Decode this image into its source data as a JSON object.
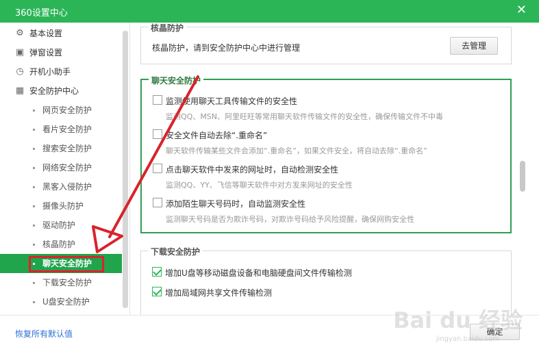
{
  "window": {
    "title": "360设置中心",
    "close_glyph": "✕"
  },
  "sidebar": {
    "items": [
      {
        "label": "基本设置",
        "icon": "gear-icon",
        "glyph": "⚙"
      },
      {
        "label": "弹窗设置",
        "icon": "window-icon",
        "glyph": "▣"
      },
      {
        "label": "开机小助手",
        "icon": "timer-icon",
        "glyph": "◷"
      },
      {
        "label": "安全防护中心",
        "icon": "shield-icon",
        "glyph": "▦"
      }
    ],
    "subitems": [
      "网页安全防护",
      "看片安全防护",
      "搜索安全防护",
      "网络安全防护",
      "黑客入侵防护",
      "摄像头防护",
      "驱动防护",
      "核晶防护",
      "聊天安全防护",
      "下载安全防护",
      "U盘安全防护"
    ],
    "active_index": 8
  },
  "core_protect": {
    "title": "核晶防护",
    "description": "核晶防护，请到安全防护中心中进行管理",
    "button": "去管理"
  },
  "chat_protect": {
    "title": "聊天安全防护",
    "options": [
      {
        "label": "监测使用聊天工具传输文件的安全性",
        "desc": "监测QQ、MSN、阿里旺旺等常用聊天软件传输文件的安全性，确保传输文件不中毒",
        "checked": false
      },
      {
        "label": "安全文件自动去除“.重命名”",
        "desc": "聊天软件传输某些文件会添加“.重命名”，如果文件安全，将自动去除“.重命名”",
        "checked": false
      },
      {
        "label": "点击聊天软件中发来的网址时，自动检测安全性",
        "desc": "监测QQ、YY、飞信等聊天软件中对方发来网址的安全性",
        "checked": false
      },
      {
        "label": "添加陌生聊天号码时，自动监测安全性",
        "desc": "监测聊天号码是否为欺诈号码，对欺诈号码给予风险提醒，确保网购安全性",
        "checked": false
      }
    ]
  },
  "download_protect": {
    "title": "下载安全防护",
    "options": [
      {
        "label": "增加U盘等移动磁盘设备和电脑硬盘间文件传输检测",
        "checked": true
      },
      {
        "label": "增加局域网共享文件传输检测",
        "checked": true
      }
    ]
  },
  "footer": {
    "restore_label": "恢复所有默认值",
    "ok_label": "确定"
  },
  "watermark": {
    "main": "Bai du 经验",
    "sub": "jingyan.baidu.com"
  },
  "colors": {
    "title_bar": "#2bb556",
    "active_item": "#20a44c",
    "highlight": "#d9232b",
    "group_border": "#2e9e52",
    "link": "#2a6fd6"
  }
}
